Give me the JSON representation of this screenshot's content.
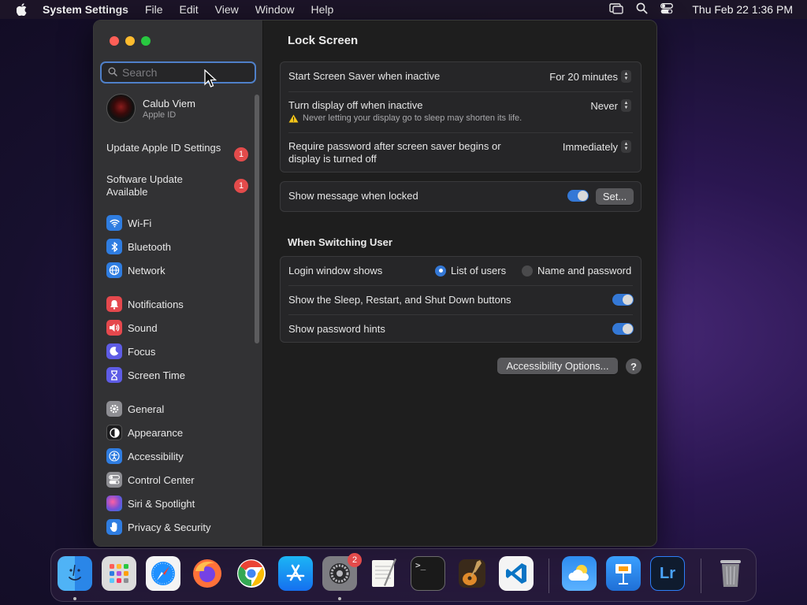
{
  "menubar": {
    "app_name": "System Settings",
    "menus": [
      "File",
      "Edit",
      "View",
      "Window",
      "Help"
    ],
    "clock": "Thu Feb 22  1:36 PM"
  },
  "sidebar": {
    "search_placeholder": "Search",
    "user": {
      "name": "Calub Viem",
      "subtitle": "Apple ID"
    },
    "notices": [
      {
        "label": "Update Apple ID Settings",
        "badge": "1"
      },
      {
        "label": "Software Update Available",
        "badge": "1"
      }
    ],
    "items": [
      {
        "label": "Wi-Fi",
        "icon": "wifi-icon",
        "color": "#2f7de1"
      },
      {
        "label": "Bluetooth",
        "icon": "bluetooth-icon",
        "color": "#2f7de1"
      },
      {
        "label": "Network",
        "icon": "network-icon",
        "color": "#2f7de1"
      },
      {
        "label": "Notifications",
        "icon": "notifications-icon",
        "color": "#e5484d"
      },
      {
        "label": "Sound",
        "icon": "sound-icon",
        "color": "#e5484d"
      },
      {
        "label": "Focus",
        "icon": "focus-icon",
        "color": "#5e5ce6"
      },
      {
        "label": "Screen Time",
        "icon": "screen-time-icon",
        "color": "#5e5ce6"
      },
      {
        "label": "General",
        "icon": "gear-icon",
        "color": "#8e8e93"
      },
      {
        "label": "Appearance",
        "icon": "appearance-icon",
        "color": "#1c1c1e"
      },
      {
        "label": "Accessibility",
        "icon": "accessibility-icon",
        "color": "#2f7de1"
      },
      {
        "label": "Control Center",
        "icon": "control-center-icon",
        "color": "#8e8e93"
      },
      {
        "label": "Siri & Spotlight",
        "icon": "siri-icon",
        "color": "#7a4fd6"
      },
      {
        "label": "Privacy & Security",
        "icon": "hand-icon",
        "color": "#2f7de1"
      }
    ]
  },
  "main": {
    "title": "Lock Screen",
    "screen_saver": {
      "label": "Start Screen Saver when inactive",
      "value": "For 20 minutes"
    },
    "display_off": {
      "label": "Turn display off when inactive",
      "value": "Never",
      "warning": "Never letting your display go to sleep may shorten its life."
    },
    "require_password": {
      "label": "Require password after screen saver begins or display is turned off",
      "value": "Immediately"
    },
    "show_message": {
      "label": "Show message when locked",
      "enabled": true,
      "button": "Set..."
    },
    "switching_title": "When Switching User",
    "login_window": {
      "label": "Login window shows",
      "options": [
        "List of users",
        "Name and password"
      ],
      "selected": "List of users"
    },
    "sleep_buttons": {
      "label": "Show the Sleep, Restart, and Shut Down buttons",
      "enabled": true
    },
    "password_hints": {
      "label": "Show password hints",
      "enabled": true
    },
    "accessibility_button": "Accessibility Options...",
    "help_button": "?"
  },
  "dock": {
    "apps": [
      "Finder",
      "Launchpad",
      "Safari",
      "Firefox",
      "Chrome",
      "App Store",
      "System Settings",
      "TextEdit",
      "Terminal",
      "GarageBand",
      "Visual Studio Code",
      "Weather",
      "Keynote",
      "Lightroom",
      "Trash"
    ],
    "settings_badge": "2",
    "terminal_glyph": ">_",
    "lightroom_glyph": "Lr"
  },
  "colors": {
    "accent": "#3478d6",
    "badge": "#e34b4b"
  }
}
